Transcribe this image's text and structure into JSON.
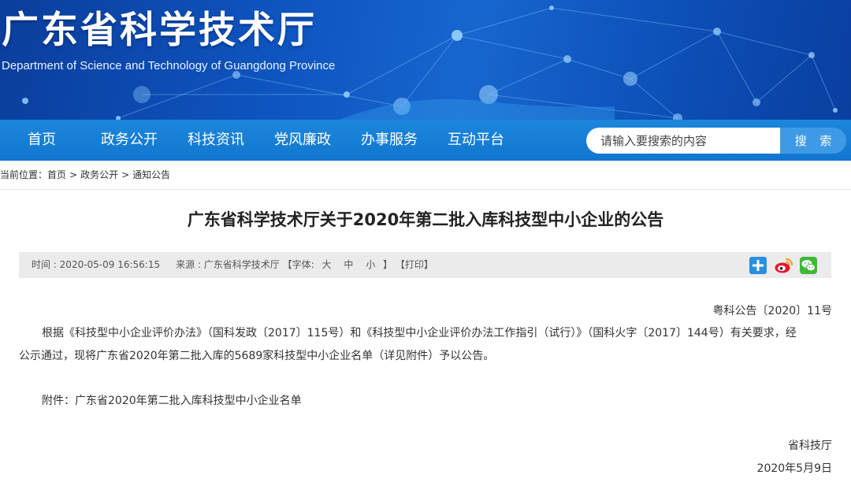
{
  "site": {
    "title": "广东省科学技术厅",
    "subtitle": "Department of Science and Technology of Guangdong Province"
  },
  "nav": {
    "items": [
      "首页",
      "政务公开",
      "科技资讯",
      "党风廉政",
      "办事服务",
      "互动平台"
    ]
  },
  "search": {
    "placeholder": "请输入要搜索的内容",
    "button_label": "搜 索"
  },
  "breadcrumb": {
    "prefix": "当前位置：",
    "items": [
      "首页",
      "政务公开",
      "通知公告"
    ],
    "separator": ">"
  },
  "article": {
    "title": "广东省科学技术厅关于2020年第二批入库科技型中小企业的公告",
    "meta": {
      "time": "时间 : 2020-05-09 16:56:15",
      "source": "来源 : 广东省科学技术厅",
      "font_label": "【字体:",
      "font_sizes": [
        "大",
        "中",
        "小"
      ],
      "font_close": "】",
      "print": "【打印】"
    },
    "share_icons": [
      "share-plus-icon",
      "weibo-icon",
      "wechat-icon"
    ],
    "doc_number": "粤科公告〔2020〕11号",
    "body_line1": "根据《科技型中小企业评价办法》（国科发政〔2017〕115号）和《科技型中小企业评价办法工作指引（试行）》（国科火字〔2017〕144号）有关要求，经",
    "body_line2": "公示通过，现将广东省2020年第二批入库的5689家科技型中小企业名单（详见附件）予以公告。",
    "attachment": "附件：广东省2020年第二批入库科技型中小企业名单",
    "signature": "省科技厅",
    "date": "2020年5月9日"
  },
  "colors": {
    "banner": "#0f56c2",
    "nav": "#1580d6",
    "search_button": "#3f9ae6",
    "meta_bar": "#ebebeb",
    "weibo": "#e6162d",
    "wechat": "#3fb837",
    "share": "#2b8fe0"
  }
}
